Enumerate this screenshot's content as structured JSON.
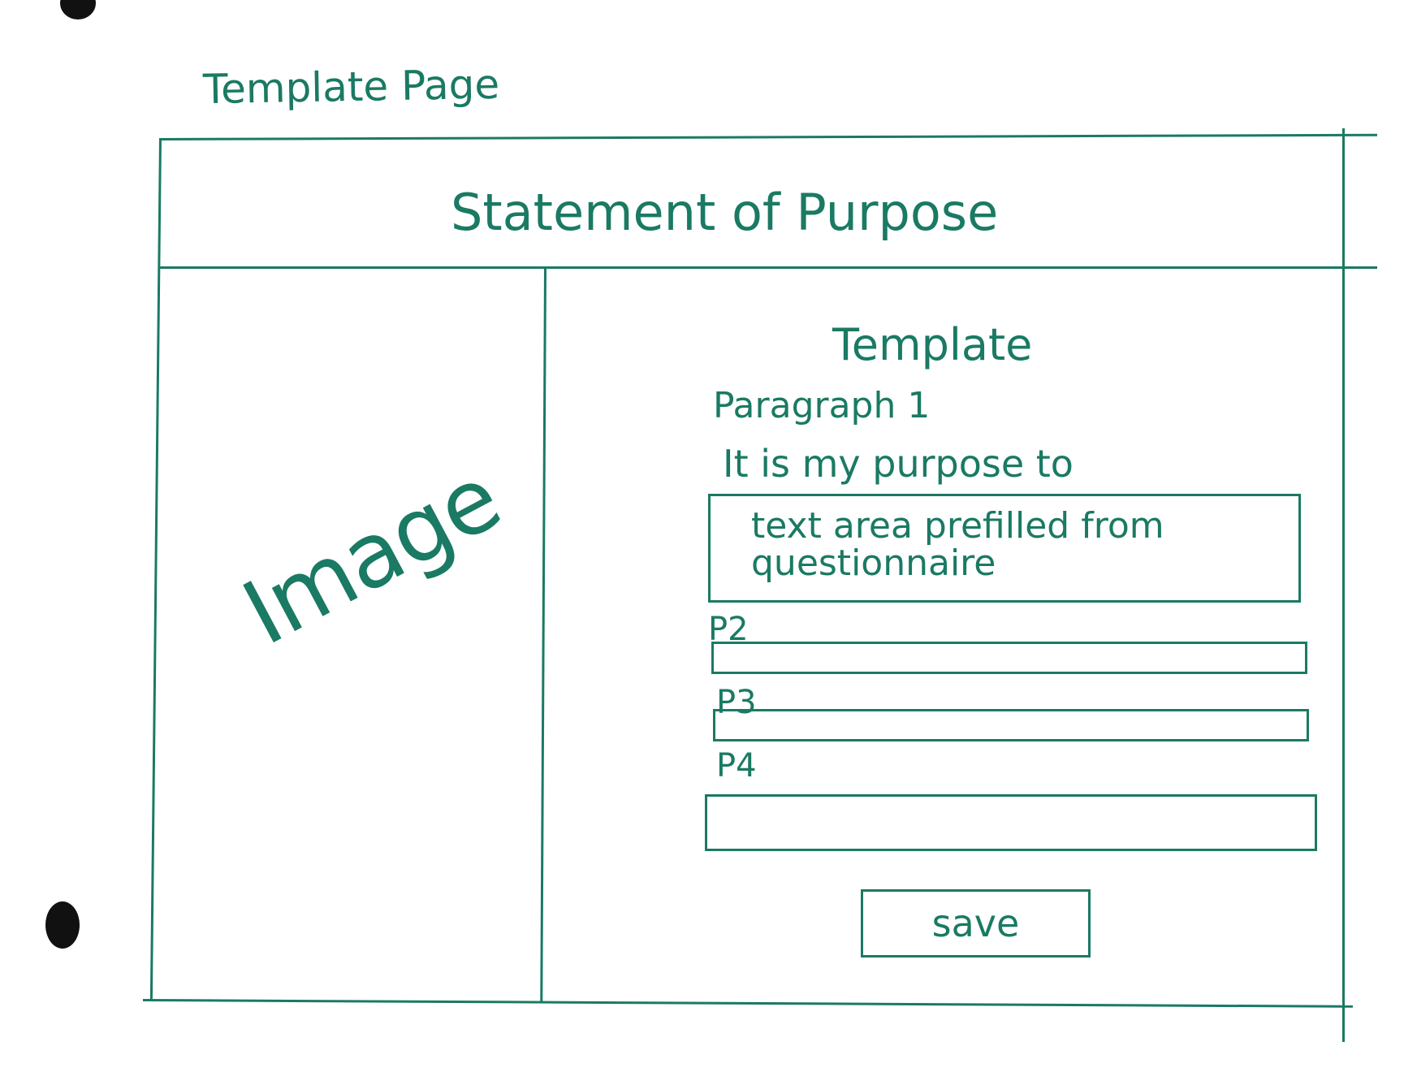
{
  "page_label": "Template Page",
  "header": {
    "title": "Statement of Purpose"
  },
  "left_panel": {
    "image_label": "Image"
  },
  "template": {
    "title": "Template",
    "paragraph1": {
      "label": "Paragraph 1",
      "lead_text": "It is my purpose to",
      "textarea_text": "text area prefilled from questionnaire"
    },
    "p2_label": "P2",
    "p3_label": "P3",
    "p4_label": "P4",
    "save_label": "save"
  },
  "colors": {
    "ink": "#1a7a63",
    "paper": "#ffffff",
    "hole": "#111111"
  }
}
